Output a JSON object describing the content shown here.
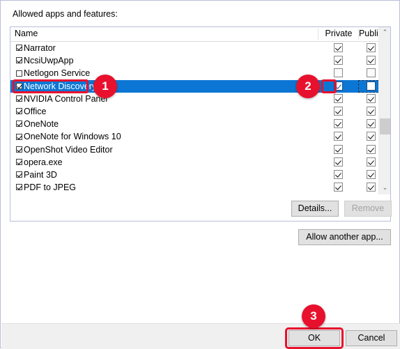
{
  "dialog": {
    "apps_label": "Allowed apps and features:"
  },
  "listview": {
    "columns": {
      "name": "Name",
      "private": "Private",
      "public": "Public"
    },
    "rows": [
      {
        "name": "Narrator",
        "allowed": true,
        "private": true,
        "public": true,
        "selected": false
      },
      {
        "name": "NcsiUwpApp",
        "allowed": true,
        "private": true,
        "public": true,
        "selected": false
      },
      {
        "name": "Netlogon Service",
        "allowed": false,
        "private": false,
        "public": false,
        "selected": false
      },
      {
        "name": "Network Discovery",
        "allowed": true,
        "private": true,
        "public": false,
        "selected": true
      },
      {
        "name": "NVIDIA Control Panel",
        "allowed": true,
        "private": true,
        "public": true,
        "selected": false
      },
      {
        "name": "Office",
        "allowed": true,
        "private": true,
        "public": true,
        "selected": false
      },
      {
        "name": "OneNote",
        "allowed": true,
        "private": true,
        "public": true,
        "selected": false
      },
      {
        "name": "OneNote for Windows 10",
        "allowed": true,
        "private": true,
        "public": true,
        "selected": false
      },
      {
        "name": "OpenShot Video Editor",
        "allowed": true,
        "private": true,
        "public": true,
        "selected": false
      },
      {
        "name": "opera.exe",
        "allowed": true,
        "private": true,
        "public": true,
        "selected": false
      },
      {
        "name": "Paint 3D",
        "allowed": true,
        "private": true,
        "public": true,
        "selected": false
      },
      {
        "name": "PDF to JPEG",
        "allowed": true,
        "private": true,
        "public": true,
        "selected": false
      }
    ],
    "scrollbar": {
      "up_arrow": "⌃",
      "down_arrow": "⌄"
    }
  },
  "buttons": {
    "details": "Details...",
    "remove": "Remove",
    "allow_another_app": "Allow another app...",
    "ok": "OK",
    "cancel": "Cancel"
  },
  "annotations": [
    {
      "id": "1",
      "label": "1",
      "target": "network-discovery-row"
    },
    {
      "id": "2",
      "label": "2",
      "target": "network-discovery-private-checkbox"
    },
    {
      "id": "3",
      "label": "3",
      "target": "ok-button"
    }
  ],
  "colors": {
    "selection_blue": "#0c76d4",
    "annotation_red": "#e8112d",
    "dialog_border": "#b9bdd8",
    "footer_bg": "#f0f0f0",
    "button_bg": "#e1e1e1"
  }
}
